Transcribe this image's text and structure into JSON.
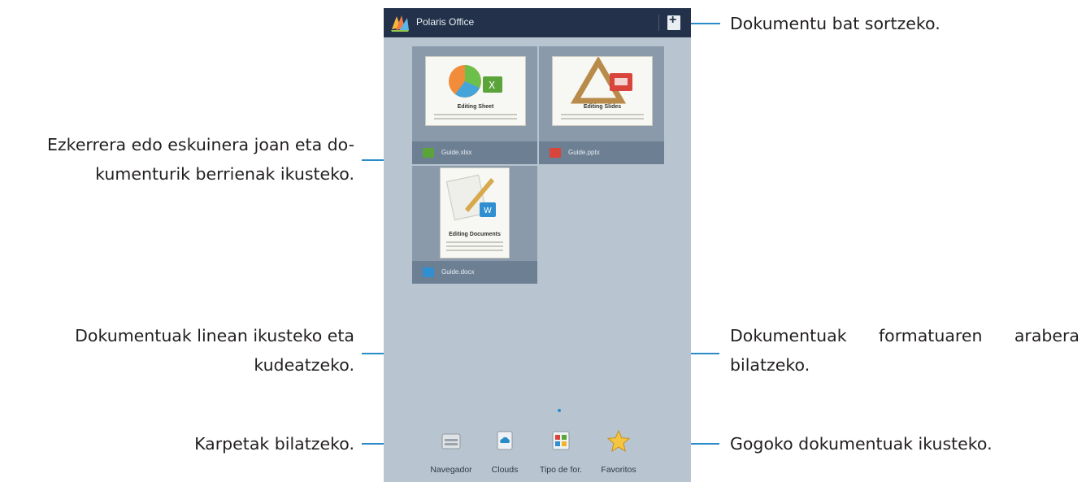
{
  "app": {
    "title": "Polaris Office"
  },
  "documents": [
    {
      "file_name": "Guide.xlsx",
      "thumb_title": "Editing Sheet",
      "type": "xlsx",
      "color": "#5aa43a"
    },
    {
      "file_name": "Guide.pptx",
      "thumb_title": "Editing Slides",
      "type": "pptx",
      "color": "#d9453a"
    },
    {
      "file_name": "Guide.docx",
      "thumb_title": "Editing Documents",
      "type": "docx",
      "color": "#2f8fd1"
    }
  ],
  "dock": [
    {
      "label": "Navegador",
      "icon": "folder-icon"
    },
    {
      "label": "Clouds",
      "icon": "cloud-icon"
    },
    {
      "label": "Tipo de for.",
      "icon": "file-types-icon"
    },
    {
      "label": "Favoritos",
      "icon": "star-icon"
    }
  ],
  "callouts": {
    "create": "Dokumentu bat sortzeko.",
    "recent_line1": "Ezkerrera edo eskuinera joan eta do-",
    "recent_line2": "kumenturik berrienak ikusteko.",
    "online_line1": "Dokumentuak linean ikusteko eta",
    "online_line2": "kudeatzeko.",
    "format_line1": "Dokumentuak formatuaren arabera",
    "format_line2": "bilatzeko.",
    "folders": "Karpetak bilatzeko.",
    "favorites": "Gogoko dokumentuak ikusteko."
  },
  "colors": {
    "callout_line": "#2a8bc9",
    "topbar": "#23324a",
    "screen_bg": "#b8c5d0"
  }
}
